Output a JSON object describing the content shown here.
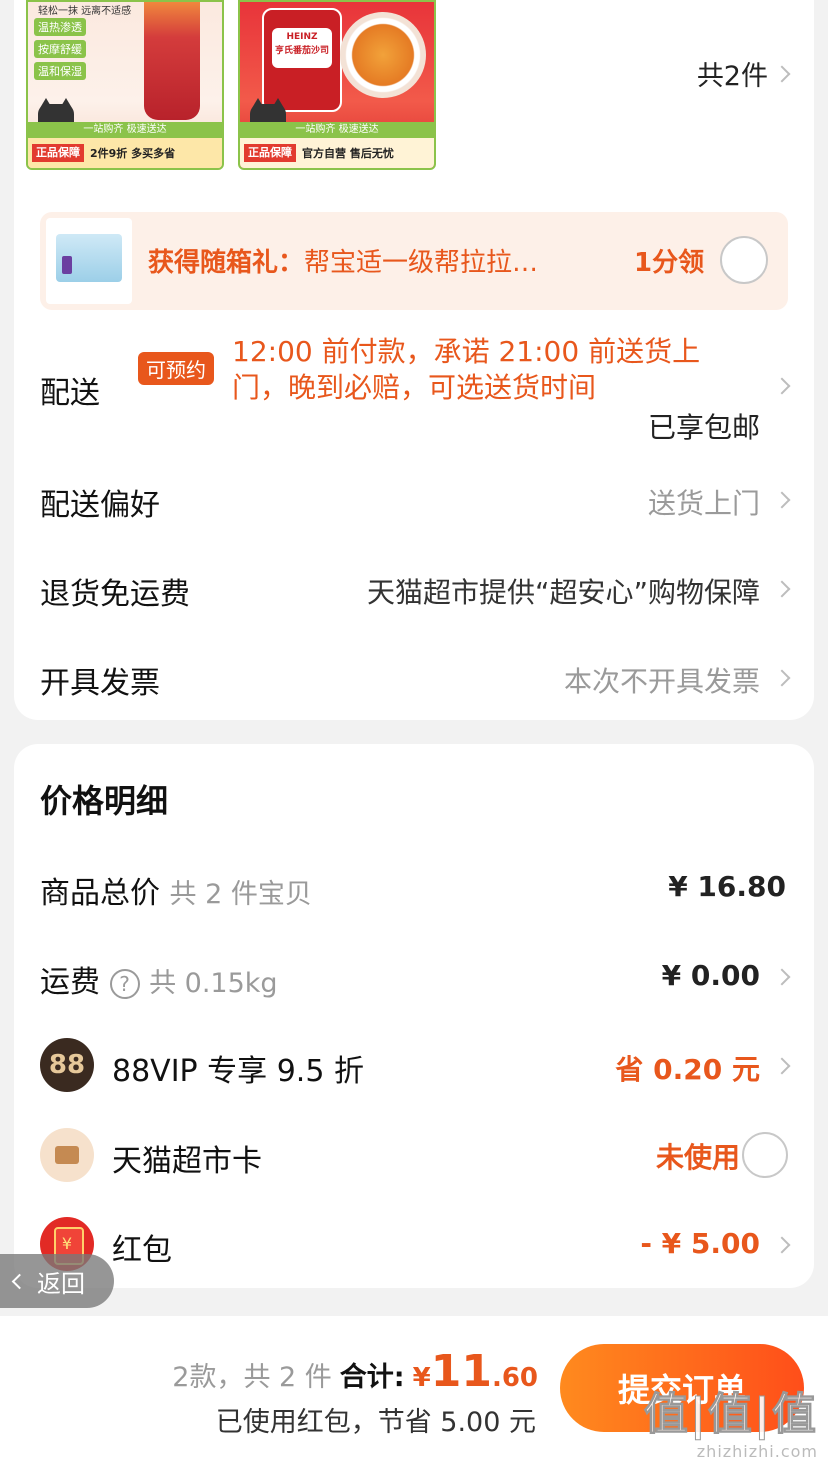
{
  "items": {
    "thumb1": {
      "topline": "轻松一抹 远离不适感",
      "features": [
        "温热渗透",
        "按摩舒缓",
        "温和保湿"
      ],
      "greenbar": "一站购齐 极速送达",
      "tag": "正品保障",
      "promo": "2件9折 多买多省"
    },
    "thumb2": {
      "brand": "HEINZ",
      "label": "亨氏番茄沙司",
      "greenbar": "一站购齐 极速送达",
      "tag": "正品保障",
      "promo": "官方自营 售后无忧"
    },
    "count": "共2件"
  },
  "gift": {
    "prefix": "获得随箱礼：",
    "name": "帮宝适一级帮拉拉…",
    "price": "1分领"
  },
  "delivery": {
    "label": "配送",
    "tag": "可预约",
    "promise": "12:00 前付款，承诺 21:00 前送货上门，晚到必赔，可选送货时间",
    "free": "已享包邮"
  },
  "preference": {
    "label": "配送偏好",
    "value": "送货上门"
  },
  "returns": {
    "label": "退货免运费",
    "value": "天猫超市提供“超安心”购物保障"
  },
  "invoice": {
    "label": "开具发票",
    "value": "本次不开具发票"
  },
  "price_detail": {
    "title": "价格明细",
    "goods_label": "商品总价",
    "goods_sub": "共 2 件宝贝",
    "goods_amount": "¥ 16.80",
    "freight_label": "运费",
    "freight_sub": "共 0.15kg",
    "freight_amount": "¥ 0.00",
    "vip_icon": "88",
    "vip_label": "88VIP 专享 9.5 折",
    "vip_amount": "省 0.20 元",
    "card_label": "天猫超市卡",
    "card_amount": "未使用",
    "redpack_icon": "¥",
    "redpack_label": "红包",
    "redpack_amount": "- ¥ 5.00"
  },
  "back": {
    "label": "返回"
  },
  "footer": {
    "summary": "2款，共 2 件",
    "total_label": "合计:",
    "yen": "¥",
    "total_int": "11",
    "total_dec": ".60",
    "saved": "已使用红包，节省 5.00 元",
    "submit": "提交订单",
    "watermark": "值|值|值",
    "watermark_url": "zhizhizhi.com"
  }
}
